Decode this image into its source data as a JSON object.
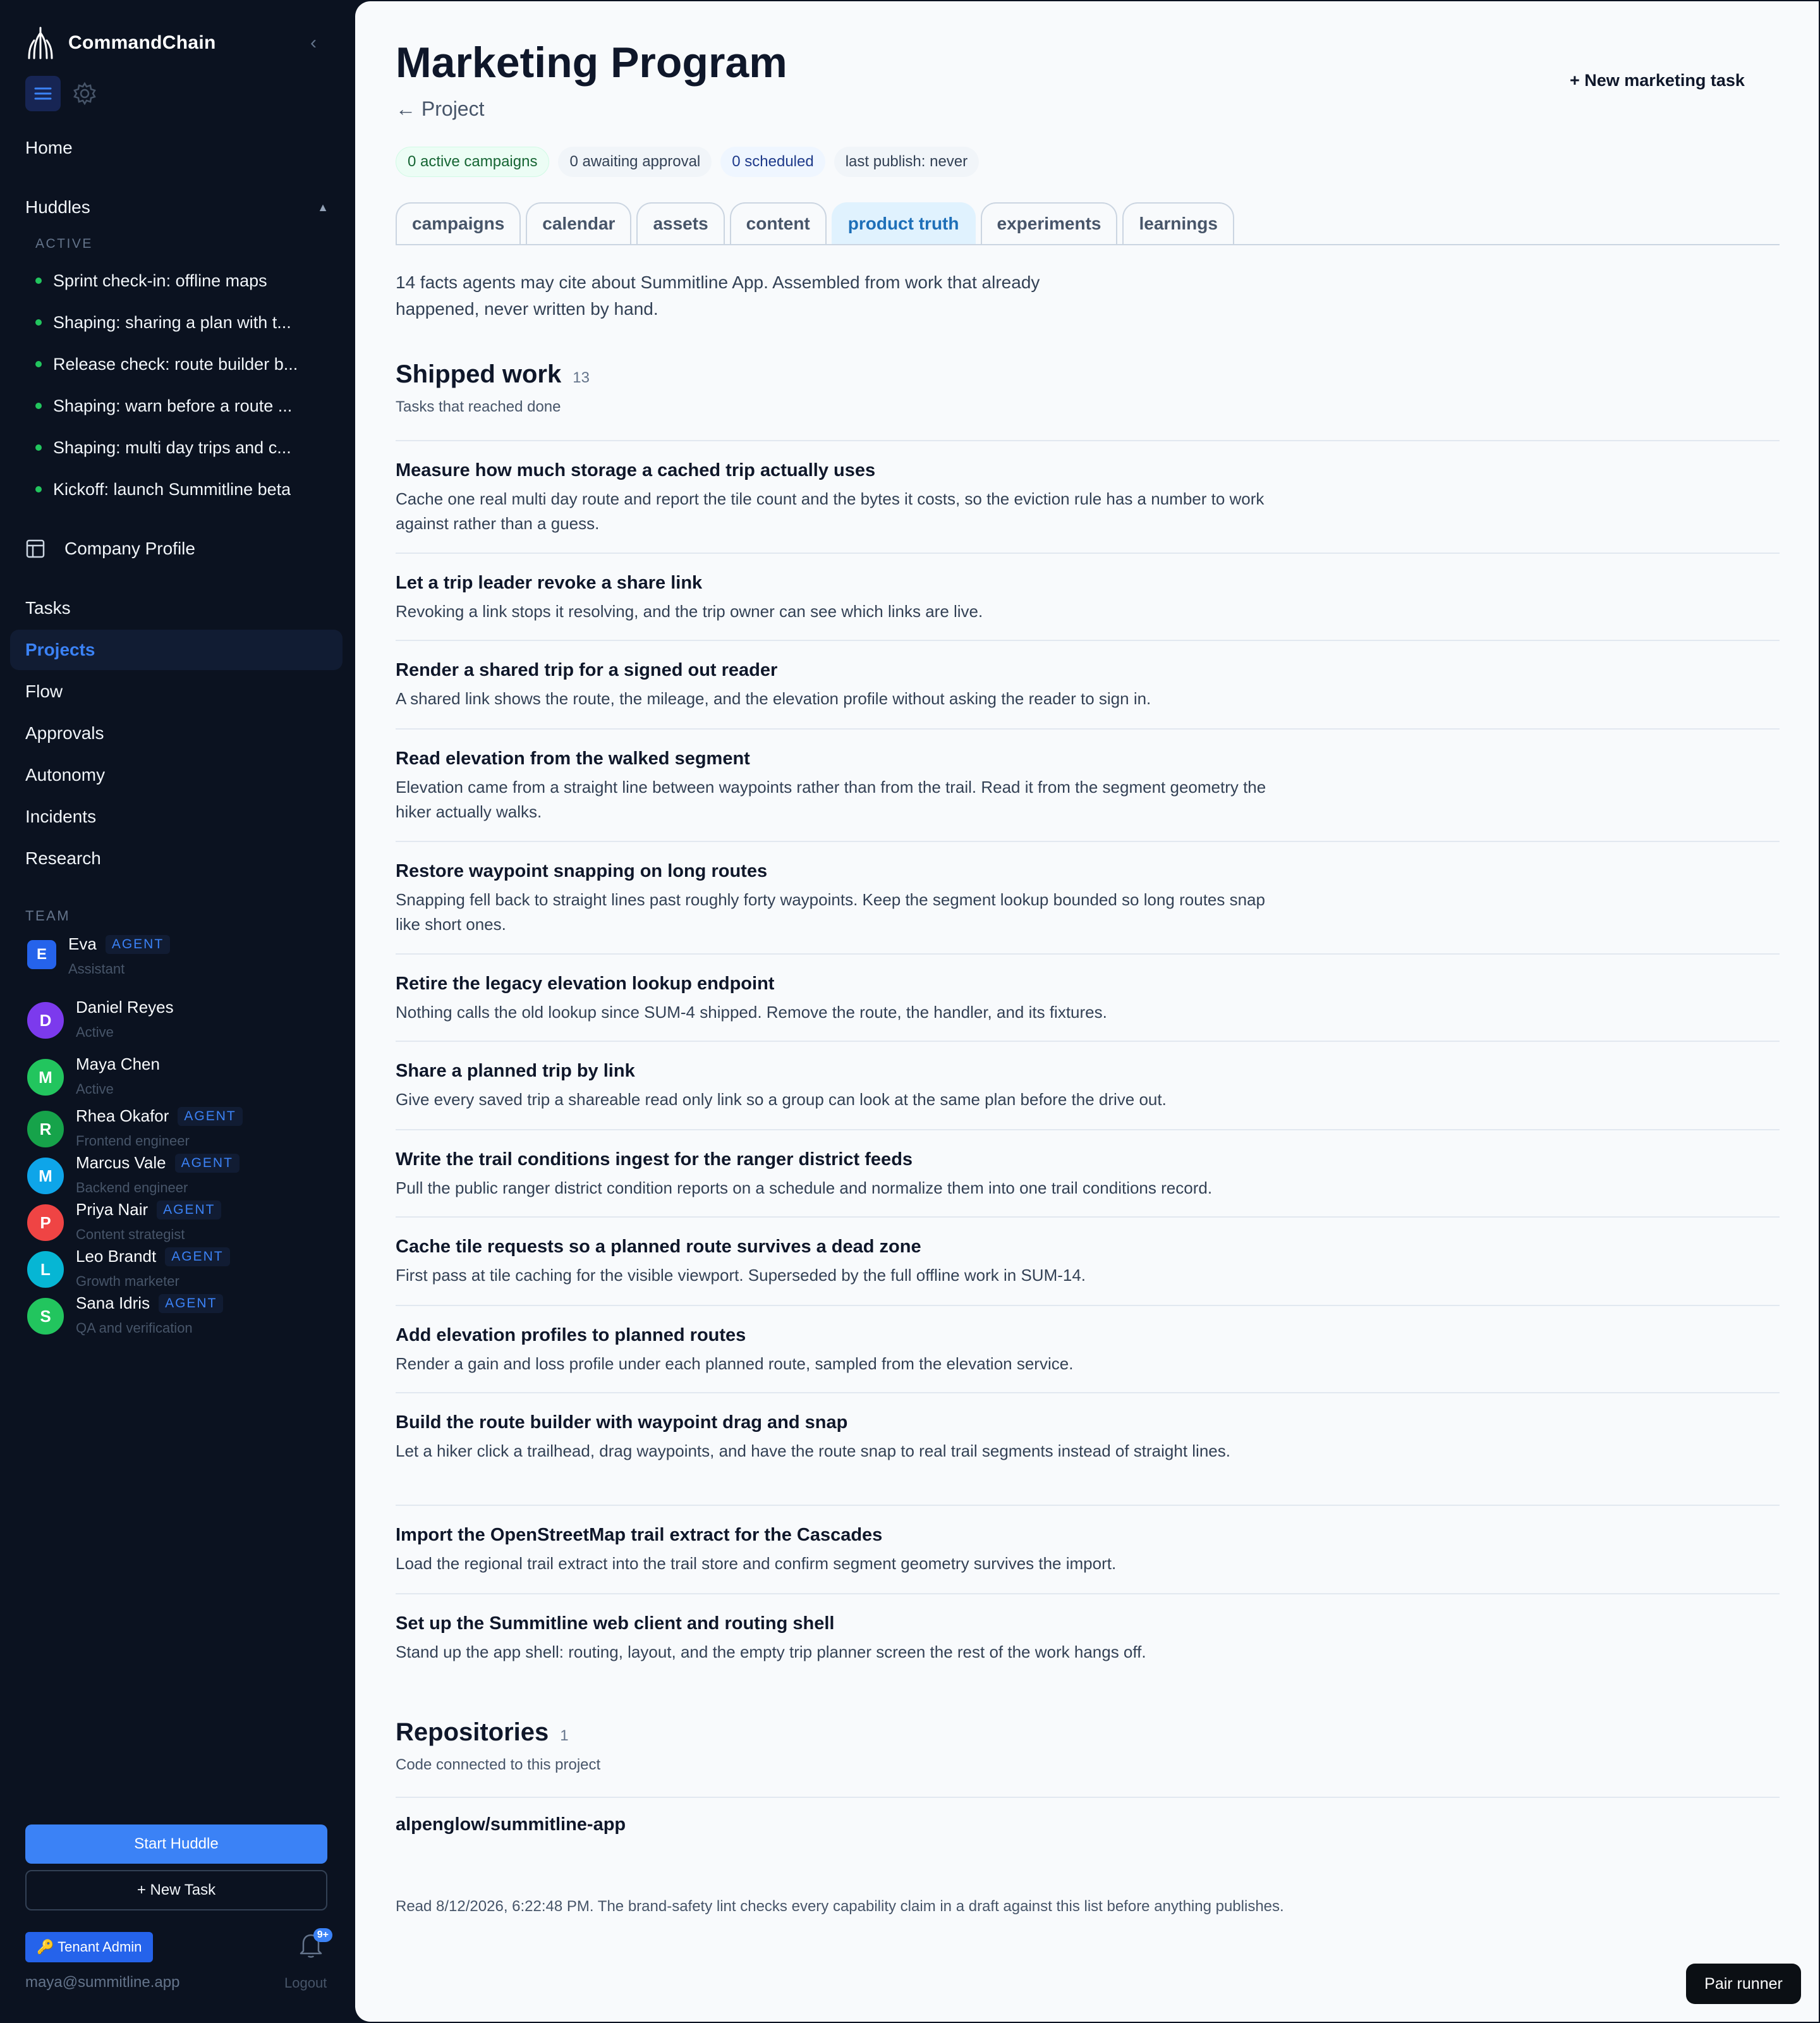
{
  "app": {
    "name": "CommandChain"
  },
  "sidebar": {
    "home": "Home",
    "huddles": {
      "label": "Huddles",
      "active_label": "ACTIVE",
      "items": [
        "Sprint check-in: offline maps",
        "Shaping: sharing a plan with t...",
        "Release check: route builder b...",
        "Shaping: warn before a route ...",
        "Shaping: multi day trips and c...",
        "Kickoff: launch Summitline beta"
      ]
    },
    "company_profile": "Company Profile",
    "nav": [
      "Tasks",
      "Projects",
      "Flow",
      "Approvals",
      "Autonomy",
      "Incidents",
      "Research"
    ],
    "active_nav": "Projects",
    "team_label": "TEAM",
    "team": [
      {
        "initial": "E",
        "name": "Eva",
        "badge": "AGENT",
        "role": "Assistant",
        "color": "#2563eb"
      },
      {
        "initial": "D",
        "name": "Daniel Reyes",
        "badge": "",
        "role": "Active",
        "color": "#7c3aed"
      },
      {
        "initial": "M",
        "name": "Maya Chen",
        "badge": "",
        "role": "Active",
        "color": "#22c55e"
      },
      {
        "initial": "R",
        "name": "Rhea Okafor",
        "badge": "AGENT",
        "role": "Frontend engineer",
        "color": "#16a34a"
      },
      {
        "initial": "M",
        "name": "Marcus Vale",
        "badge": "AGENT",
        "role": "Backend engineer",
        "color": "#0ea5e9"
      },
      {
        "initial": "P",
        "name": "Priya Nair",
        "badge": "AGENT",
        "role": "Content strategist",
        "color": "#ef4444"
      },
      {
        "initial": "L",
        "name": "Leo Brandt",
        "badge": "AGENT",
        "role": "Growth marketer",
        "color": "#06b6d4"
      },
      {
        "initial": "S",
        "name": "Sana Idris",
        "badge": "AGENT",
        "role": "QA and verification",
        "color": "#22c55e"
      }
    ],
    "start_huddle": "Start Huddle",
    "new_task": "+ New Task",
    "tenant_admin": "🔑 Tenant Admin",
    "notifications": "9+",
    "email": "maya@summitline.app",
    "logout": "Logout"
  },
  "main": {
    "title": "Marketing Program",
    "back": "← Project",
    "new_task": "+ New marketing task",
    "pills": [
      {
        "text": "0 active campaigns",
        "style": "green"
      },
      {
        "text": "0 awaiting approval",
        "style": "grey"
      },
      {
        "text": "0 scheduled",
        "style": "blue"
      },
      {
        "text": "last publish: never",
        "style": "grey"
      }
    ],
    "tabs": [
      "campaigns",
      "calendar",
      "assets",
      "content",
      "product truth",
      "experiments",
      "learnings"
    ],
    "active_tab": "product truth",
    "intro": "14 facts agents may cite about Summitline App. Assembled from work that already happened, never written by hand.",
    "shipped": {
      "title": "Shipped work",
      "count": "13",
      "subtitle": "Tasks that reached done",
      "items": [
        {
          "title": "Measure how much storage a cached trip actually uses",
          "desc": "Cache one real multi day route and report the tile count and the bytes it costs, so the eviction rule has a number to work against rather than a guess."
        },
        {
          "title": "Let a trip leader revoke a share link",
          "desc": "Revoking a link stops it resolving, and the trip owner can see which links are live."
        },
        {
          "title": "Render a shared trip for a signed out reader",
          "desc": "A shared link shows the route, the mileage, and the elevation profile without asking the reader to sign in."
        },
        {
          "title": "Read elevation from the walked segment",
          "desc": "Elevation came from a straight line between waypoints rather than from the trail. Read it from the segment geometry the hiker actually walks."
        },
        {
          "title": "Restore waypoint snapping on long routes",
          "desc": "Snapping fell back to straight lines past roughly forty waypoints. Keep the segment lookup bounded so long routes snap like short ones."
        },
        {
          "title": "Retire the legacy elevation lookup endpoint",
          "desc": "Nothing calls the old lookup since SUM-4 shipped. Remove the route, the handler, and its fixtures."
        },
        {
          "title": "Share a planned trip by link",
          "desc": "Give every saved trip a shareable read only link so a group can look at the same plan before the drive out."
        },
        {
          "title": "Write the trail conditions ingest for the ranger district feeds",
          "desc": "Pull the public ranger district condition reports on a schedule and normalize them into one trail conditions record."
        },
        {
          "title": "Cache tile requests so a planned route survives a dead zone",
          "desc": "First pass at tile caching for the visible viewport. Superseded by the full offline work in SUM-14."
        },
        {
          "title": "Add elevation profiles to planned routes",
          "desc": "Render a gain and loss profile under each planned route, sampled from the elevation service."
        },
        {
          "title": "Build the route builder with waypoint drag and snap",
          "desc": "Let a hiker click a trailhead, drag waypoints, and have the route snap to real trail segments instead of straight lines."
        },
        {
          "title": "Import the OpenStreetMap trail extract for the Cascades",
          "desc": "Load the regional trail extract into the trail store and confirm segment geometry survives the import."
        },
        {
          "title": "Set up the Summitline web client and routing shell",
          "desc": "Stand up the app shell: routing, layout, and the empty trip planner screen the rest of the work hangs off."
        }
      ]
    },
    "repositories": {
      "title": "Repositories",
      "count": "1",
      "subtitle": "Code connected to this project",
      "items": [
        "alpenglow/summitline-app"
      ]
    },
    "footnote": "Read 8/12/2026, 6:22:48 PM. The brand-safety lint checks every capability claim in a draft against this list before anything publishes.",
    "pair_runner": "Pair runner"
  }
}
